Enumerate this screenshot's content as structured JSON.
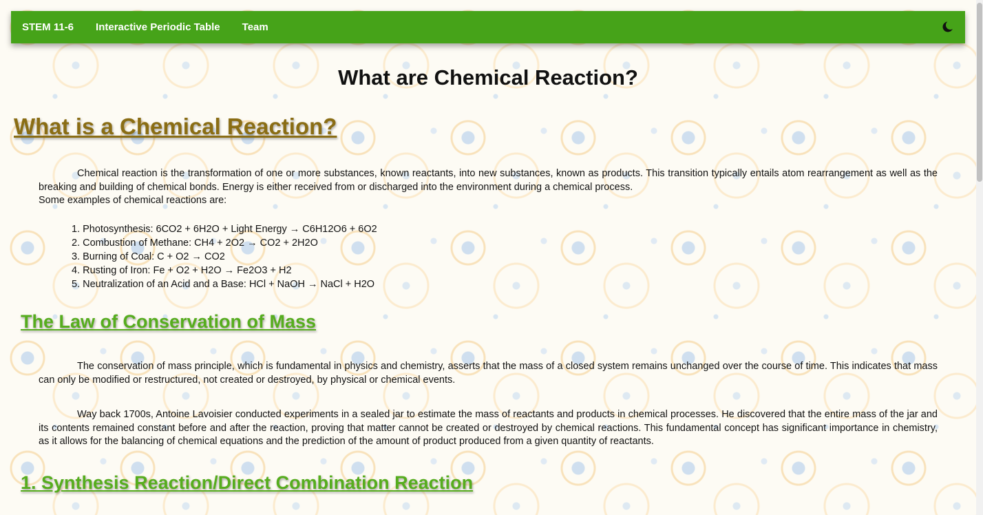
{
  "nav": {
    "brand": "STEM 11-6",
    "links": [
      "Interactive Periodic Table",
      "Team"
    ],
    "theme_icon": "moon-icon"
  },
  "page_title": "What are Chemical Reaction?",
  "section1": {
    "heading": "What is a Chemical Reaction?",
    "paragraph": "Chemical reaction is the transformation of one or more substances, known reactants, into new substances, known as products. This transition typically entails atom rearrangement as well as the breaking and building of chemical bonds. Energy is either received from or discharged into the environment during a chemical process.",
    "examples_intro": "Some examples of chemical reactions are:",
    "examples": [
      "1. Photosynthesis: 6CO2 + 6H2O + Light Energy → C6H12O6 + 6O2",
      "2. Combustion of Methane: CH4 + 2O2 → CO2 + 2H2O",
      "3. Burning of Coal: C + O2 → CO2",
      "4. Rusting of Iron: Fe + O2 + H2O → Fe2O3 + H2",
      "5. Neutralization of an Acid and a Base: HCl + NaOH → NaCl + H2O"
    ]
  },
  "section2": {
    "heading": "The Law of Conservation of Mass",
    "paragraph1": "The conservation of mass principle, which is fundamental in physics and chemistry, asserts that the mass of a closed system remains unchanged over the course of time. This indicates that mass can only be modified or restructured, not created or destroyed, by physical or chemical events.",
    "paragraph2": "Way back 1700s, Antoine Lavoisier conducted experiments in a sealed jar to estimate the mass of reactants and products in chemical processes. He discovered that the entire mass of the jar and its contents remained constant before and after the reaction, proving that matter cannot be created or destroyed by chemical reactions. This fundamental concept has significant importance in chemistry, as it allows for the balancing of chemical equations and the prediction of the amount of product produced from a given quantity of reactants."
  },
  "section3": {
    "heading": "1. Synthesis Reaction/Direct Combination Reaction"
  },
  "colors": {
    "navbar": "#46a319",
    "main_heading": "#8a6d14",
    "sub_heading": "#56ad1e"
  }
}
